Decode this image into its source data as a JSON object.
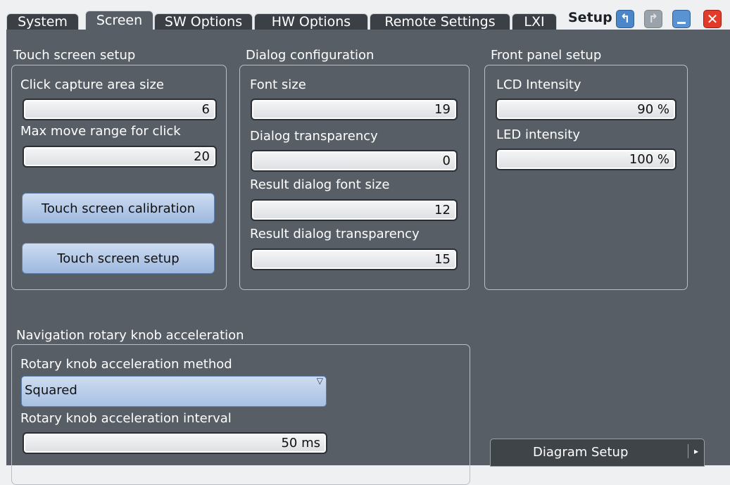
{
  "tabs": [
    {
      "label": "System",
      "active": false
    },
    {
      "label": "Screen",
      "active": true
    },
    {
      "label": "SW Options",
      "active": false
    },
    {
      "label": "HW Options",
      "active": false
    },
    {
      "label": "Remote Settings",
      "active": false
    },
    {
      "label": "LXI",
      "active": false
    }
  ],
  "titlebar": {
    "title": "Setup",
    "buttons": [
      "back-icon",
      "forward-icon",
      "minimize-icon",
      "close-icon"
    ]
  },
  "touch_screen": {
    "title": "Touch screen setup",
    "click_capture_label": "Click capture area size",
    "click_capture_value": "6",
    "max_move_label": "Max move range for click",
    "max_move_value": "20",
    "calibration_button": "Touch screen calibration",
    "setup_button": "Touch screen setup"
  },
  "dialog_config": {
    "title": "Dialog configuration",
    "font_size_label": "Font size",
    "font_size_value": "19",
    "transparency_label": "Dialog transparency",
    "transparency_value": "0",
    "result_font_label": "Result dialog font size",
    "result_font_value": "12",
    "result_transparency_label": "Result dialog transparency",
    "result_transparency_value": "15"
  },
  "front_panel": {
    "title": "Front panel setup",
    "lcd_label": "LCD Intensity",
    "lcd_value": "90 %",
    "led_label": "LED intensity",
    "led_value": "100 %"
  },
  "rotary": {
    "title": "Navigation rotary knob acceleration",
    "method_label": "Rotary knob acceleration method",
    "method_value": "Squared",
    "interval_label": "Rotary knob acceleration interval",
    "interval_value": "50 ms"
  },
  "diagram_setup_button": "Diagram Setup",
  "colors": {
    "background": "#575e66",
    "tab_inactive": "#3b4046",
    "button_blue": "#9db8df",
    "close_red": "#e33b2a"
  }
}
